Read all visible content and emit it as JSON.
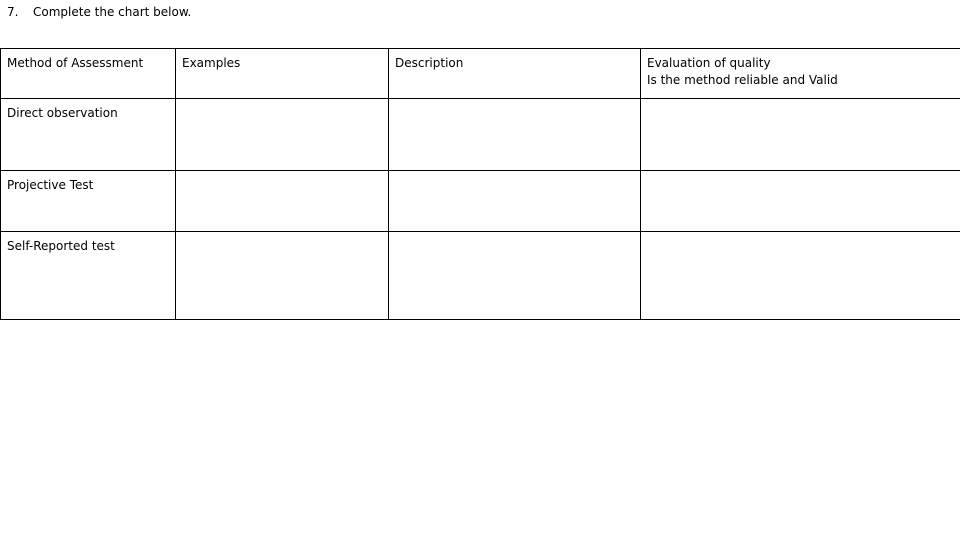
{
  "heading": {
    "number": "7.",
    "text": "Complete the chart below."
  },
  "table": {
    "headers": [
      "Method of Assessment",
      "Examples",
      "Description",
      "Evaluation of quality",
      "Is the method reliable and Valid"
    ],
    "rows": [
      {
        "method": "Direct observation",
        "examples": "",
        "description": "",
        "evaluation": ""
      },
      {
        "method": "Projective Test",
        "examples": "",
        "description": "",
        "evaluation": ""
      },
      {
        "method": "Self-Reported test",
        "examples": "",
        "description": "",
        "evaluation": ""
      }
    ]
  }
}
